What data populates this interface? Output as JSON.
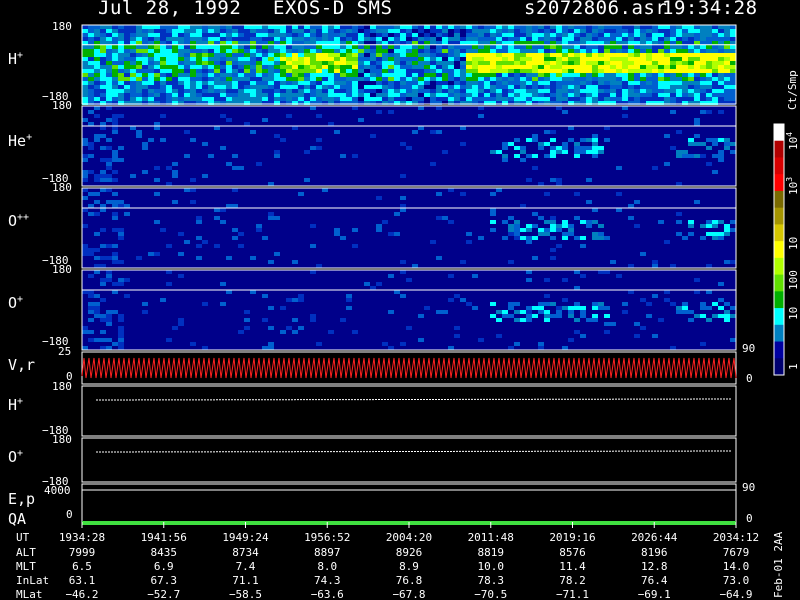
{
  "header": {
    "date": "Jul 28, 1992",
    "instrument": "EXOS-D SMS",
    "file": "s2072806.asr",
    "time": "19:34:28"
  },
  "panels": [
    {
      "id": "h",
      "label": "H",
      "sup": "+",
      "top_tick": "180",
      "bottom_tick": "−180"
    },
    {
      "id": "he",
      "label": "He",
      "sup": "+",
      "top_tick": "180",
      "bottom_tick": "−180"
    },
    {
      "id": "opp",
      "label": "O",
      "sup": "++",
      "top_tick": "180",
      "bottom_tick": "−180"
    },
    {
      "id": "op",
      "label": "O",
      "sup": "+",
      "top_tick": "180",
      "bottom_tick": "−180"
    }
  ],
  "line_panels": {
    "vr": {
      "label": "V,r",
      "top_tick": "25",
      "bottom_tick": "0",
      "right_top": "90",
      "right_bottom": "0"
    },
    "h2": {
      "label": "H",
      "sup": "+",
      "top_tick": "180",
      "bottom_tick": "−180"
    },
    "o2": {
      "label": "O",
      "sup": "+",
      "top_tick": "180",
      "bottom_tick": "−180"
    },
    "ep": {
      "label": "E,p",
      "label2": "QA",
      "top_tick": "4000",
      "bottom_tick": "0",
      "right_top": "90",
      "right_bottom": "0"
    }
  },
  "colorbar": {
    "unit": "Ct/Smp",
    "ticks": [
      "10",
      "10",
      "10",
      "100",
      "10",
      "1"
    ],
    "tick_sups": [
      "4",
      "3",
      "",
      "",
      "",
      ""
    ],
    "colors": [
      "#ffffff",
      "#b00000",
      "#d80000",
      "#ff0000",
      "#7a6a00",
      "#a59500",
      "#d6c600",
      "#ffff00",
      "#b0ff00",
      "#60e000",
      "#00b000",
      "#00ffff",
      "#0080c0",
      "#0000a0",
      "#000070"
    ]
  },
  "side_note": "Feb-01 2AA",
  "chart_data": {
    "type": "heatmap",
    "x": [
      "1934:28",
      "1941:56",
      "1949:24",
      "1956:52",
      "2004:20",
      "2011:48",
      "2019:16",
      "2026:44",
      "2034:12"
    ],
    "row_labels": [
      "UT",
      "ALT",
      "MLT",
      "InLat",
      "MLat"
    ],
    "rows": {
      "ALT": [
        "7999",
        "8435",
        "8734",
        "8897",
        "8926",
        "8819",
        "8576",
        "8196",
        "7679"
      ],
      "MLT": [
        "6.5",
        "6.9",
        "7.4",
        "8.0",
        "8.9",
        "10.0",
        "11.4",
        "12.8",
        "14.0"
      ],
      "InLat": [
        "63.1",
        "67.3",
        "71.1",
        "74.3",
        "76.8",
        "78.3",
        "78.2",
        "76.4",
        "73.0"
      ],
      "MLat": [
        "−46.2",
        "−52.7",
        "−58.5",
        "−63.6",
        "−67.8",
        "−70.5",
        "−71.1",
        "−69.1",
        "−64.9"
      ]
    },
    "ylim": [
      -180,
      180
    ],
    "colorscale": "log",
    "zlim": [
      1,
      10000
    ]
  }
}
